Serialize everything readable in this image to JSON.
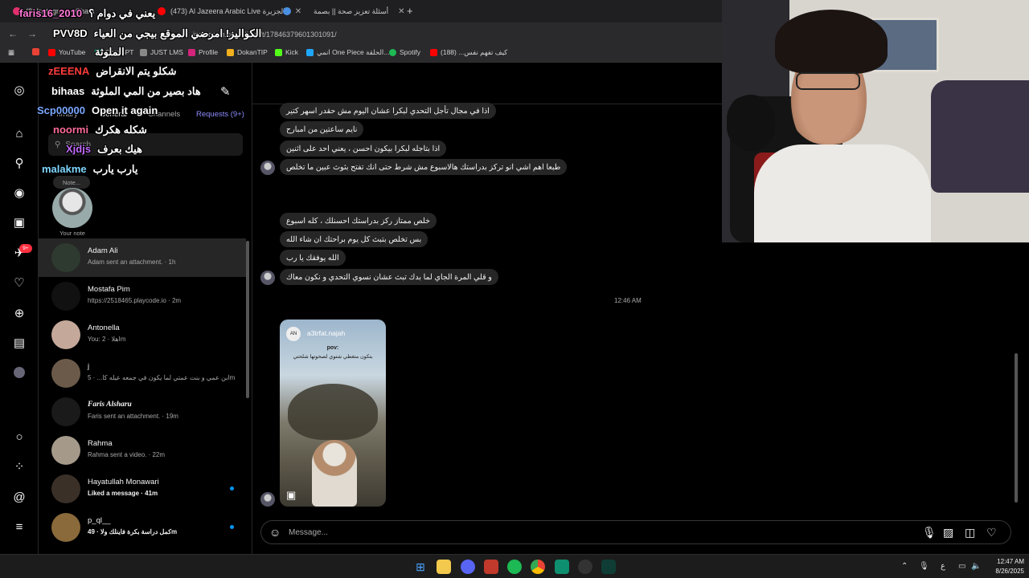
{
  "browser": {
    "tabs": [
      {
        "label": "(8) Instagram • Chats",
        "favicon_color": "#e1306c"
      },
      {
        "label": "(473) Al Jazeera Arabic Live الجزيرة",
        "favicon_color": "#ff0000"
      },
      {
        "label": "أسئلة تعزيز صحة || بصمة",
        "favicon_color": "#4a90e2"
      }
    ],
    "new_tab": "+",
    "url": "instagram.com/direct/t/17846379601301091/",
    "bookmarks": [
      {
        "label": "",
        "color": "#ea4335"
      },
      {
        "label": "YouTube",
        "color": "#ff0000"
      },
      {
        "label": "ChatGPT",
        "color": "#10a37f"
      },
      {
        "label": "JUST LMS",
        "color": "#888888"
      },
      {
        "label": "Profile",
        "color": "#d4237a"
      },
      {
        "label": "DokanTIP",
        "color": "#f2b01e"
      },
      {
        "label": "Kick",
        "color": "#53fc18"
      },
      {
        "label": "انمي One Piece الحلقة...",
        "color": "#1ea7fd"
      },
      {
        "label": "Spotify",
        "color": "#1db954"
      },
      {
        "label": "كيف تفهم نفس... (188)",
        "color": "#ff0000"
      }
    ]
  },
  "stream_chat": [
    {
      "user": "faris16_2010",
      "user_color": "#ff7ad9",
      "text": "يعني في دوام ؟"
    },
    {
      "user": "PVV8D",
      "user_color": "#ffffff",
      "text": "الكواليز! امرضي الموقع بيجي من العياء"
    },
    {
      "user": "",
      "user_color": "#ffffff",
      "text": "الملوثة"
    },
    {
      "user": "zEEENA",
      "user_color": "#ff3b3b",
      "text": "شكلو يتم الانقراض"
    },
    {
      "user": "bihaas",
      "user_color": "#ffffff",
      "text": "هاد بصير من المي الملوثة"
    },
    {
      "user": "Scp00000",
      "user_color": "#7aa7ff",
      "text": "Open it again"
    },
    {
      "user": "noormi",
      "user_color": "#ff6b9a",
      "text": "شكله هكرك"
    },
    {
      "user": "Xjdjs",
      "user_color": "#c46cff",
      "text": "هيك بعرف"
    },
    {
      "user": "malakme",
      "user_color": "#7fd6ff",
      "text": "يارب يارب"
    }
  ],
  "inbox": {
    "tabs": [
      "Primary",
      "General",
      "Channels"
    ],
    "requests": "Requests (9+)",
    "search_placeholder": "Search",
    "note_bubble": "Note...",
    "note_label": "Your note",
    "conversations": [
      {
        "name": "Adam Ali",
        "preview": "Adam sent an attachment. · 1h",
        "active": true,
        "unread": false,
        "serif": false,
        "bold": false
      },
      {
        "name": "Mostafa Pim",
        "preview": "https://2518465.playcode.io · 2m",
        "active": false,
        "unread": false,
        "serif": false,
        "bold": false
      },
      {
        "name": "Antonella",
        "preview": "You: اهلا · 2m",
        "active": false,
        "unread": false,
        "serif": false,
        "bold": false
      },
      {
        "name": "j",
        "preview": "ابن عمي و بنت عمتي لما يكون في جمعه عيله كا... · 5m",
        "active": false,
        "unread": false,
        "serif": false,
        "bold": false
      },
      {
        "name": "Faris Alsharu",
        "preview": "Faris sent an attachment. · 19m",
        "active": false,
        "unread": false,
        "serif": true,
        "bold": false
      },
      {
        "name": "Rahma",
        "preview": "Rahma sent a video. · 22m",
        "active": false,
        "unread": false,
        "serif": false,
        "bold": false
      },
      {
        "name": "Hayatullah Monawari",
        "preview": "Liked a message · 41m",
        "active": false,
        "unread": true,
        "serif": false,
        "bold": true
      },
      {
        "name": "p_ql__",
        "preview": "كمل دراسة بكرة فاينلك ولا · 49m",
        "active": false,
        "unread": true,
        "serif": false,
        "bold": true
      }
    ]
  },
  "rail": {
    "notification_badge": "9+",
    "icons": [
      "instagram-icon",
      "home-icon",
      "search-icon",
      "explore-icon",
      "reels-icon",
      "messages-icon",
      "notifications-icon",
      "create-icon",
      "dashboard-icon",
      "profile-avatar",
      "threads-icon",
      "more-icon"
    ]
  },
  "chat": {
    "messages": [
      {
        "text": "اذا في مجال تأجل التحدي لبكرا عشان اليوم مش حقدر اسهر كتير",
        "avatar": false
      },
      {
        "text": "نايم ساعتين من امبارح",
        "avatar": false
      },
      {
        "text": "اذا بتاجله لبكرا بيكون احسن ، يعني احد على اثنين",
        "avatar": false
      },
      {
        "text": "طبعا اهم اشي انو تركز بدراستك هالاسبوع مش شرط حتى انك تفتح بثوث عبين ما تخلص",
        "avatar": true
      },
      {
        "text": "خلص ممتاز ركز بدراستك احسنلك ، كله اسبوع",
        "avatar": false
      },
      {
        "text": "بس تخلص بتبث كل يوم براحتك ان شاء الله",
        "avatar": false
      },
      {
        "text": "الله يوفقك يا رب",
        "avatar": false
      },
      {
        "text": "و قلي المرة الجاي لما بدك تبث عشان نسوي التحدي و نكون معاك",
        "avatar": true
      }
    ],
    "timestamp": "12:46 AM",
    "reel": {
      "username": "a3trfat.najah",
      "avatar_text": "AN",
      "pov": "pov:",
      "caption": "بتكون متغطي شتوي لصحوتها شلحتي"
    },
    "composer_placeholder": "Message..."
  },
  "taskbar": {
    "time": "12:47 AM",
    "date": "8/26/2025",
    "lang": "ع"
  }
}
